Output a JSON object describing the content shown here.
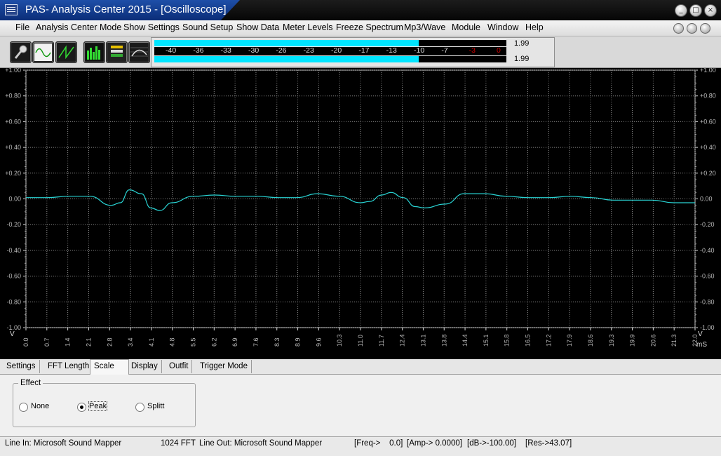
{
  "window": {
    "title": "PAS- Analysis Center 2015 - [Oscilloscope]",
    "buttons": [
      "_",
      "□",
      "×"
    ]
  },
  "menu": [
    "File",
    "Analysis Center Mode",
    "Show Settings",
    "Sound Setup",
    "Show Data",
    "Meter Levels",
    "Freeze Spectrum",
    "Mp3/Wave",
    "Module",
    "Window",
    "Help"
  ],
  "toolbar": {
    "buttons": [
      "microphone-icon",
      "sine-wave-icon",
      "sawtooth-wave-icon",
      "spectrum-bars-icon",
      "meter-panel-icon",
      "curve-graph-icon"
    ]
  },
  "meter": {
    "ticks": [
      "-40",
      "-36",
      "-33",
      "-30",
      "-26",
      "-23",
      "-20",
      "-17",
      "-13",
      "-10",
      "-7",
      "-3",
      "0"
    ],
    "level_top": "1.99",
    "level_bottom": "1.99",
    "fill_fraction": 0.75,
    "colors": {
      "fill": "#00e5ff",
      "hot": "#d00000"
    }
  },
  "scope": {
    "y_labels": [
      "+1.00",
      "+0.80",
      "+0.60",
      "+0.40",
      "+0.20",
      "0.00",
      "-0.20",
      "-0.40",
      "-0.60",
      "-0.80",
      "-1.00"
    ],
    "y_unit": "V",
    "x_labels": [
      "0.0",
      "0.7",
      "1.4",
      "2.1",
      "2.8",
      "3.4",
      "4.1",
      "4.8",
      "5.5",
      "6.2",
      "6.9",
      "7.6",
      "8.3",
      "8.9",
      "9.6",
      "10.3",
      "11.0",
      "11.7",
      "12.4",
      "13.1",
      "13.8",
      "14.4",
      "15.1",
      "15.8",
      "16.5",
      "17.2",
      "17.9",
      "18.6",
      "19.3",
      "19.9",
      "20.6",
      "21.3",
      "22.0"
    ],
    "x_unit": "mS",
    "trace_color": "#29d4d4"
  },
  "chart_data": {
    "type": "line",
    "x": [
      0.0,
      0.7,
      1.4,
      2.1,
      2.8,
      3.1,
      3.4,
      3.8,
      4.1,
      4.4,
      4.8,
      5.5,
      6.2,
      6.9,
      7.6,
      8.3,
      8.9,
      9.6,
      10.3,
      11.0,
      11.3,
      11.7,
      12.0,
      12.4,
      12.8,
      13.1,
      13.8,
      14.4,
      15.1,
      15.8,
      16.5,
      17.2,
      17.9,
      18.6,
      19.3,
      19.9,
      20.6,
      21.3,
      22.0
    ],
    "series": [
      {
        "values": [
          0.01,
          0.01,
          0.02,
          0.02,
          -0.05,
          -0.03,
          0.07,
          0.04,
          -0.07,
          -0.09,
          -0.03,
          0.02,
          0.03,
          0.02,
          0.02,
          0.01,
          0.01,
          0.04,
          0.02,
          -0.03,
          -0.02,
          0.03,
          0.05,
          0.01,
          -0.06,
          -0.07,
          -0.04,
          0.04,
          0.04,
          0.02,
          0.01,
          0.01,
          0.02,
          0.01,
          -0.01,
          -0.01,
          -0.01,
          -0.03,
          -0.03
        ]
      }
    ],
    "xlabel": "mS",
    "ylabel": "V",
    "xlim": [
      0,
      22.0
    ],
    "ylim": [
      -1.0,
      1.0
    ],
    "grid": true
  },
  "tabs": [
    "Settings",
    "FFT Length",
    "Scale",
    "Display",
    "Outfit",
    "Trigger Mode"
  ],
  "active_tab": "Scale",
  "effect": {
    "title": "Effect",
    "options": [
      {
        "label": "None",
        "selected": false
      },
      {
        "label": "Peak",
        "selected": true
      },
      {
        "label": "Splitt",
        "selected": false
      }
    ]
  },
  "status": {
    "line_in": "Line In: Microsoft Sound Mapper",
    "fft": "1024 FFT",
    "line_out": "Line Out: Microsoft Sound Mapper",
    "freq": "[Freq->    0.0]",
    "amp": "[Amp-> 0.0000]",
    "db": "[dB->-100.00]",
    "res": "[Res->43.07]"
  }
}
